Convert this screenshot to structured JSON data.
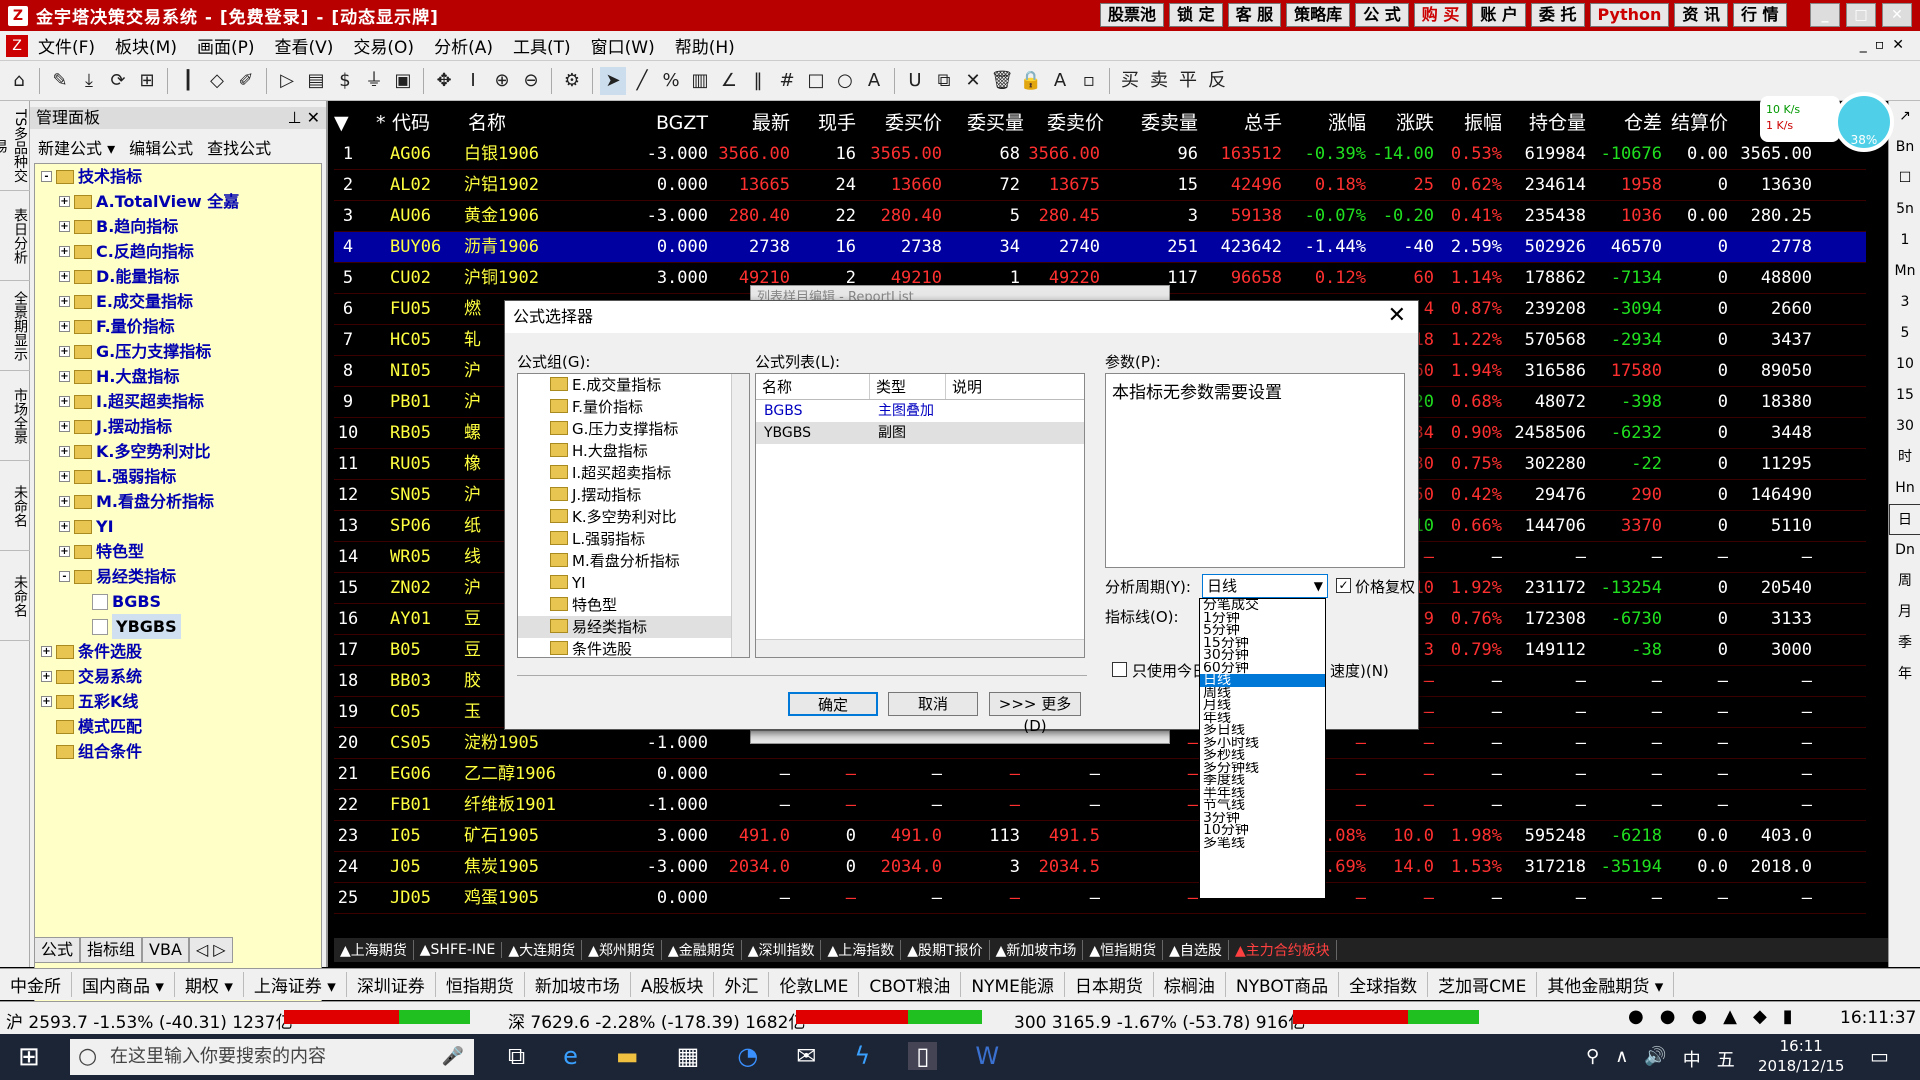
{
  "titlebar": {
    "title": "金宇塔决策交易系统 - [免费登录] - [动态显示牌]",
    "buttons": [
      "股票池",
      "锁 定",
      "客 服",
      "策略库",
      "公 式",
      "购 买",
      "账 户",
      "委 托",
      "Python",
      "资 讯",
      "行 情"
    ]
  },
  "menu": [
    "文件(F)",
    "板块(M)",
    "画面(P)",
    "查看(V)",
    "交易(O)",
    "分析(A)",
    "工具(T)",
    "窗口(W)",
    "帮助(H)"
  ],
  "left_vtabs": [
    "TS多品种交易",
    "表日分析",
    "全景期显示",
    "市场全景",
    "未命名",
    "未命名"
  ],
  "panel": {
    "header": "管理面板",
    "tools": [
      "新建公式 ▾",
      "编辑公式",
      "查找公式"
    ],
    "tree": [
      {
        "label": "技术指标",
        "level": 0,
        "exp": "-"
      },
      {
        "label": "A.TotalView 全嘉",
        "level": 1,
        "exp": "+"
      },
      {
        "label": "B.趋向指标",
        "level": 1,
        "exp": "+"
      },
      {
        "label": "C.反趋向指标",
        "level": 1,
        "exp": "+"
      },
      {
        "label": "D.能量指标",
        "level": 1,
        "exp": "+"
      },
      {
        "label": "E.成交量指标",
        "level": 1,
        "exp": "+"
      },
      {
        "label": "F.量价指标",
        "level": 1,
        "exp": "+"
      },
      {
        "label": "G.压力支撑指标",
        "level": 1,
        "exp": "+"
      },
      {
        "label": "H.大盘指标",
        "level": 1,
        "exp": "+"
      },
      {
        "label": "I.超买超卖指标",
        "level": 1,
        "exp": "+"
      },
      {
        "label": "J.摆动指标",
        "level": 1,
        "exp": "+"
      },
      {
        "label": "K.多空势利对比",
        "level": 1,
        "exp": "+"
      },
      {
        "label": "L.强弱指标",
        "level": 1,
        "exp": "+"
      },
      {
        "label": "M.看盘分析指标",
        "level": 1,
        "exp": "+"
      },
      {
        "label": "YI",
        "level": 1,
        "exp": "+"
      },
      {
        "label": "特色型",
        "level": 1,
        "exp": "+"
      },
      {
        "label": "易经类指标",
        "level": 1,
        "exp": "-"
      },
      {
        "label": "BGBS",
        "level": 2,
        "exp": ""
      },
      {
        "label": "YBGBS",
        "level": 2,
        "exp": "",
        "sel": true
      },
      {
        "label": "条件选股",
        "level": 0,
        "exp": "+"
      },
      {
        "label": "交易系统",
        "level": 0,
        "exp": "+"
      },
      {
        "label": "五彩K线",
        "level": 0,
        "exp": "+"
      },
      {
        "label": "模式匹配",
        "level": 0,
        "exp": ""
      },
      {
        "label": "组合条件",
        "level": 0,
        "exp": ""
      }
    ],
    "tabs": [
      "公式",
      "指标组",
      "VBA",
      "◁ ▷"
    ]
  },
  "grid": {
    "headers": [
      "▼",
      "*",
      "代码",
      "名称",
      "BGZT",
      "最新",
      "现手",
      "委买价",
      "委买量",
      "委卖价",
      "委卖量",
      "总手",
      "涨幅",
      "涨跌",
      "振幅",
      "持仓量",
      "仓差",
      "结算价"
    ],
    "rows": [
      [
        "1",
        "AG06",
        "白银1906",
        "-3.000",
        "3566.00",
        "16",
        "3565.00",
        "68",
        "3566.00",
        "96",
        "163512",
        "-0.39%",
        "-14.00",
        "0.53%",
        "619984",
        "-10676",
        "0.00",
        "3565.00"
      ],
      [
        "2",
        "AL02",
        "沪铝1902",
        "0.000",
        "13665",
        "24",
        "13660",
        "72",
        "13675",
        "15",
        "42496",
        "0.18%",
        "25",
        "0.62%",
        "234614",
        "1958",
        "0",
        "13630"
      ],
      [
        "3",
        "AU06",
        "黄金1906",
        "-3.000",
        "280.40",
        "22",
        "280.40",
        "5",
        "280.45",
        "3",
        "59138",
        "-0.07%",
        "-0.20",
        "0.41%",
        "235438",
        "1036",
        "0.00",
        "280.25"
      ],
      [
        "4",
        "BUY06",
        "沥青1906",
        "0.000",
        "2738",
        "16",
        "2738",
        "34",
        "2740",
        "251",
        "423642",
        "-1.44%",
        "-40",
        "2.59%",
        "502926",
        "46570",
        "0",
        "2778"
      ],
      [
        "5",
        "CU02",
        "沪铜1902",
        "3.000",
        "49210",
        "2",
        "49210",
        "1",
        "49220",
        "117",
        "96658",
        "0.12%",
        "60",
        "1.14%",
        "178862",
        "-7134",
        "0",
        "48800"
      ],
      [
        "6",
        "FU05",
        "燃",
        "",
        "",
        "",
        "",
        "",
        "",
        "",
        "",
        "",
        "4",
        "0.87%",
        "239208",
        "-3094",
        "0",
        "2660"
      ],
      [
        "7",
        "HC05",
        "轧",
        "",
        "",
        "",
        "",
        "",
        "",
        "",
        "",
        "",
        "18",
        "1.22%",
        "570568",
        "-2934",
        "0",
        "3437"
      ],
      [
        "8",
        "NI05",
        "沪",
        "",
        "",
        "",
        "",
        "",
        "",
        "",
        "",
        "",
        "1260",
        "1.94%",
        "316586",
        "17580",
        "0",
        "89050"
      ],
      [
        "9",
        "PB01",
        "沪",
        "",
        "",
        "",
        "",
        "",
        "",
        "",
        "",
        "",
        "-20",
        "0.68%",
        "48072",
        "-398",
        "0",
        "18380"
      ],
      [
        "10",
        "RB05",
        "螺",
        "",
        "",
        "",
        "",
        "",
        "",
        "",
        "",
        "",
        "34",
        "0.90%",
        "2458506",
        "-6232",
        "0",
        "3448"
      ],
      [
        "11",
        "RU05",
        "橡",
        "",
        "",
        "",
        "",
        "",
        "",
        "",
        "",
        "",
        "30",
        "0.75%",
        "302280",
        "-22",
        "0",
        "11295"
      ],
      [
        "12",
        "SN05",
        "沪",
        "",
        "",
        "",
        "",
        "",
        "",
        "",
        "",
        "",
        "50",
        "0.42%",
        "29476",
        "290",
        "0",
        "146490"
      ],
      [
        "13",
        "SP06",
        "纸",
        "",
        "",
        "",
        "",
        "",
        "",
        "",
        "",
        "",
        "-10",
        "0.66%",
        "144706",
        "3370",
        "0",
        "5110"
      ],
      [
        "14",
        "WR05",
        "线",
        "",
        "",
        "",
        "",
        "",
        "",
        "",
        "",
        "",
        "—",
        "—",
        "—",
        "—",
        "—",
        "—"
      ],
      [
        "15",
        "ZN02",
        "沪",
        "",
        "",
        "",
        "",
        "",
        "",
        "",
        "",
        "",
        "10",
        "1.92%",
        "231172",
        "-13254",
        "0",
        "20540"
      ],
      [
        "16",
        "AY01",
        "豆",
        "",
        "",
        "",
        "",
        "",
        "",
        "",
        "",
        "",
        "9",
        "0.76%",
        "172308",
        "-6730",
        "0",
        "3133"
      ],
      [
        "17",
        "B05",
        "豆",
        "",
        "",
        "",
        "",
        "",
        "",
        "",
        "",
        "",
        "3",
        "0.79%",
        "149112",
        "-38",
        "0",
        "3000"
      ],
      [
        "18",
        "BB03",
        "胶",
        "",
        "",
        "",
        "",
        "",
        "",
        "",
        "",
        "",
        "—",
        "—",
        "—",
        "—",
        "—",
        "—"
      ],
      [
        "19",
        "C05",
        "玉",
        "",
        "",
        "",
        "",
        "",
        "",
        "",
        "",
        "",
        "—",
        "—",
        "—",
        "—",
        "—",
        "—"
      ],
      [
        "20",
        "CS05",
        "淀粉1905",
        "-1.000",
        "—",
        "—",
        "—",
        "—",
        "—",
        "—",
        "—",
        "—",
        "—",
        "—",
        "—",
        "—",
        "—",
        "—"
      ],
      [
        "21",
        "EG06",
        "乙二醇1906",
        "0.000",
        "—",
        "—",
        "—",
        "—",
        "—",
        "—",
        "—",
        "—",
        "—",
        "—",
        "—",
        "—",
        "—",
        "—"
      ],
      [
        "22",
        "FB01",
        "纤维板1901",
        "-1.000",
        "—",
        "—",
        "—",
        "—",
        "—",
        "—",
        "—",
        "—",
        "—",
        "—",
        "—",
        "—",
        "—",
        "—"
      ],
      [
        "23",
        "I05",
        "矿石1905",
        "3.000",
        "491.0",
        "0",
        "491.0",
        "113",
        "491.5",
        "",
        "",
        "2.08%",
        "10.0",
        "1.98%",
        "595248",
        "-6218",
        "0.0",
        "403.0"
      ],
      [
        "24",
        "J05",
        "焦炭1905",
        "-3.000",
        "2034.0",
        "0",
        "2034.0",
        "3",
        "2034.5",
        "",
        "",
        "0.69%",
        "14.0",
        "1.53%",
        "317218",
        "-35194",
        "0.0",
        "2018.0"
      ],
      [
        "25",
        "JD05",
        "鸡蛋1905",
        "0.000",
        "—",
        "—",
        "—",
        "—",
        "—",
        "—",
        "—",
        "—",
        "—",
        "—",
        "—",
        "—",
        "—",
        "—"
      ]
    ]
  },
  "bottom_tabs": [
    "▲上海期货",
    "▲SHFE-INE",
    "▲大连期货",
    "▲郑州期货",
    "▲金融期货",
    "▲深圳指数",
    "▲上海指数",
    "▲股期T报价",
    "▲新加坡市场",
    "▲恒指期货",
    "▲自选股",
    "▲主力合约板块"
  ],
  "market_bar": [
    "中金所",
    "国内商品 ▾",
    "期权 ▾",
    "上海证券 ▾",
    "深圳证券",
    "恒指期货",
    "新加坡市场",
    "A股板块",
    "外汇",
    "伦敦LME",
    "CBOT粮油",
    "NYME能源",
    "日本期货",
    "棕榈油",
    "NYBOT商品",
    "全球指数",
    "芝加哥CME",
    "其他金融期货 ▾"
  ],
  "status": {
    "sh": "沪 2593.7  -1.53%  (-40.31)  1237亿",
    "sz": "深 7629.6  -2.28%  (-178.39)  1682亿",
    "hs300": "300  3165.9  -1.67%  (-53.78)  916亿",
    "time": "16:11:37"
  },
  "taskbar": {
    "search": "在这里输入你要搜索的内容",
    "clock_time": "16:11",
    "clock_date": "2018/12/15",
    "ime": "中"
  },
  "netspeed": {
    "up": "10 K/s",
    "down": "1 K/s",
    "pct": "38%"
  },
  "dialog": {
    "title": "公式选择器",
    "bg_title": "列表样目编辑 - ReportList",
    "group_label": "公式组(G):",
    "groups": [
      "E.成交量指标",
      "F.量价指标",
      "G.压力支撑指标",
      "H.大盘指标",
      "I.超买超卖指标",
      "J.摆动指标",
      "K.多空势利对比",
      "L.强弱指标",
      "M.看盘分析指标",
      "YI",
      "特色型",
      "易经类指标",
      "条件选股"
    ],
    "list_label": "公式列表(L):",
    "list_headers": [
      "名称",
      "类型",
      "说明"
    ],
    "list_rows": [
      [
        "BGBS",
        "主图叠加"
      ],
      [
        "YBGBS",
        "副图"
      ]
    ],
    "param_label": "参数(P):",
    "param_text": "本指标无参数需要设置",
    "period_label": "分析周期(Y):",
    "period_value": "日线",
    "fq_label": "价格复权",
    "indicator_label": "指标线(O):",
    "only_today": "只使用今日",
    "speed": "速度)(N)",
    "ok": "确定",
    "cancel": "取消",
    "more": ">>> 更多(D)"
  },
  "period_options": [
    "分笔成交",
    "1分钟",
    "5分钟",
    "15分钟",
    "30分钟",
    "60分钟",
    "日线",
    "周线",
    "月线",
    "年线",
    "多日线",
    "多小时线",
    "多秒线",
    "多分钟线",
    "季度线",
    "半年线",
    "节气线",
    "3分钟",
    "10分钟",
    "多笔线"
  ],
  "colors": {
    "title": "#b80000",
    "highlight": "#0000a0",
    "up": "#ff3030",
    "down": "#20e020"
  }
}
